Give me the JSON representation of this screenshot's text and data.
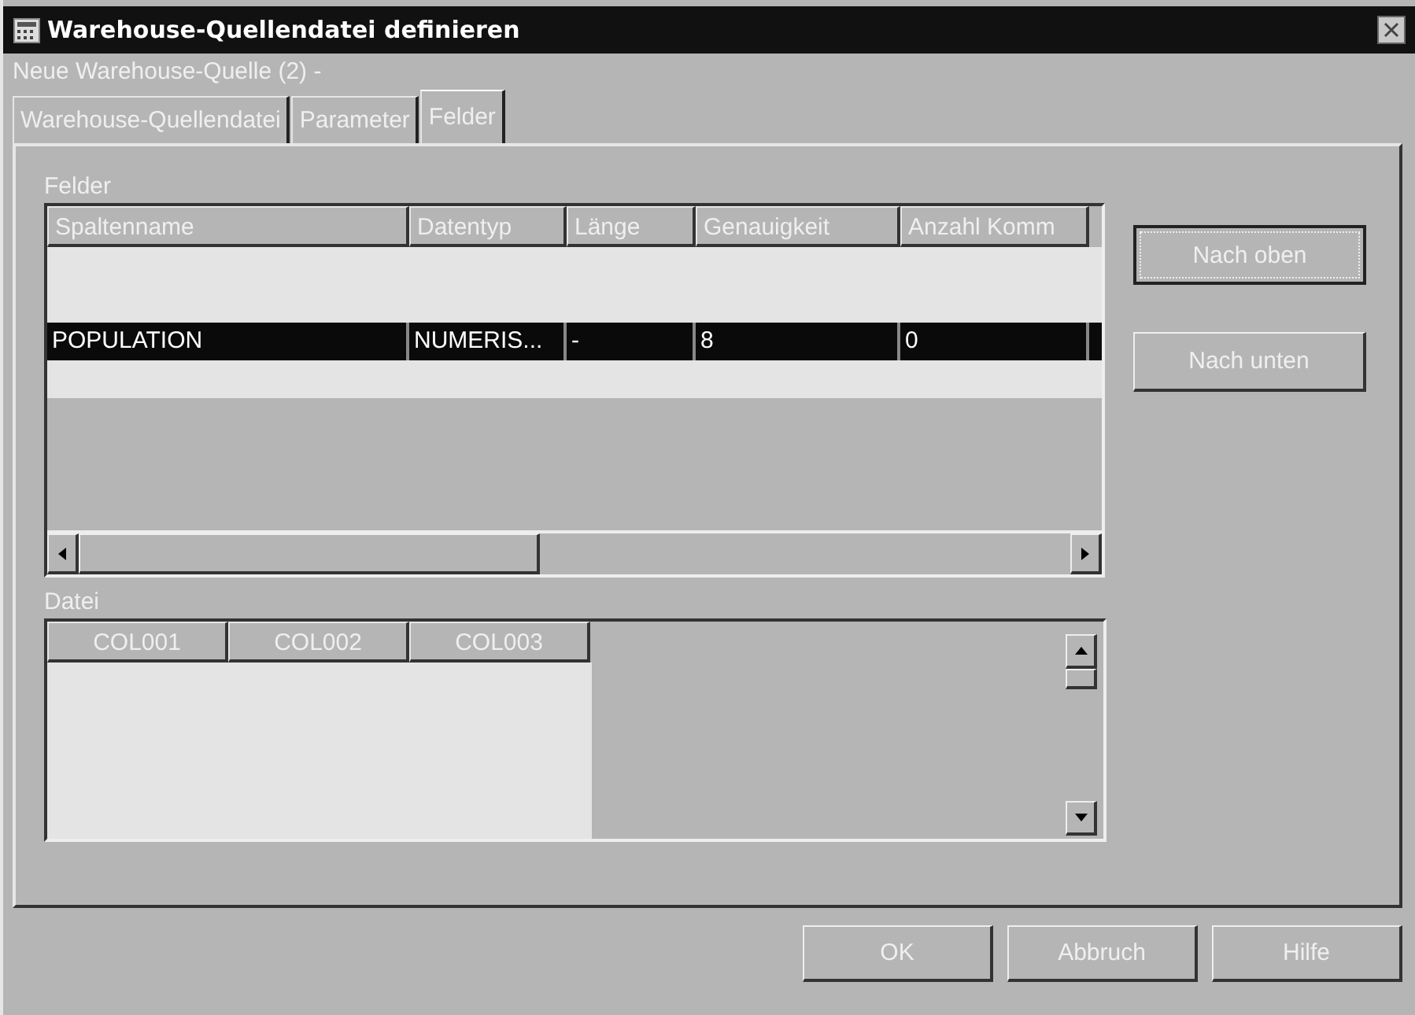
{
  "window": {
    "title": "Warehouse-Quellendatei definieren"
  },
  "subtitle": "Neue Warehouse-Quelle (2) -",
  "tabs": [
    {
      "label": "Warehouse-Quellendatei",
      "selected": false
    },
    {
      "label": "Parameter",
      "selected": false
    },
    {
      "label": "Felder",
      "selected": true
    }
  ],
  "fields_group": {
    "label": "Felder",
    "table": {
      "columns": [
        "Spaltenname",
        "Datentyp",
        "Länge",
        "Genauigkeit",
        "Anzahl Komm"
      ],
      "rows": [
        {
          "cells": [
            "POPULATION",
            "NUMERIS...",
            "-",
            "8",
            "0"
          ],
          "selected": true
        }
      ]
    }
  },
  "side_buttons": [
    {
      "label": "Nach oben",
      "focused": true
    },
    {
      "label": "Nach unten",
      "focused": false
    }
  ],
  "file_group": {
    "label": "Datei",
    "columns": [
      "COL001",
      "COL002",
      "COL003"
    ]
  },
  "buttons": [
    "OK",
    "Abbruch",
    "Hilfe"
  ]
}
